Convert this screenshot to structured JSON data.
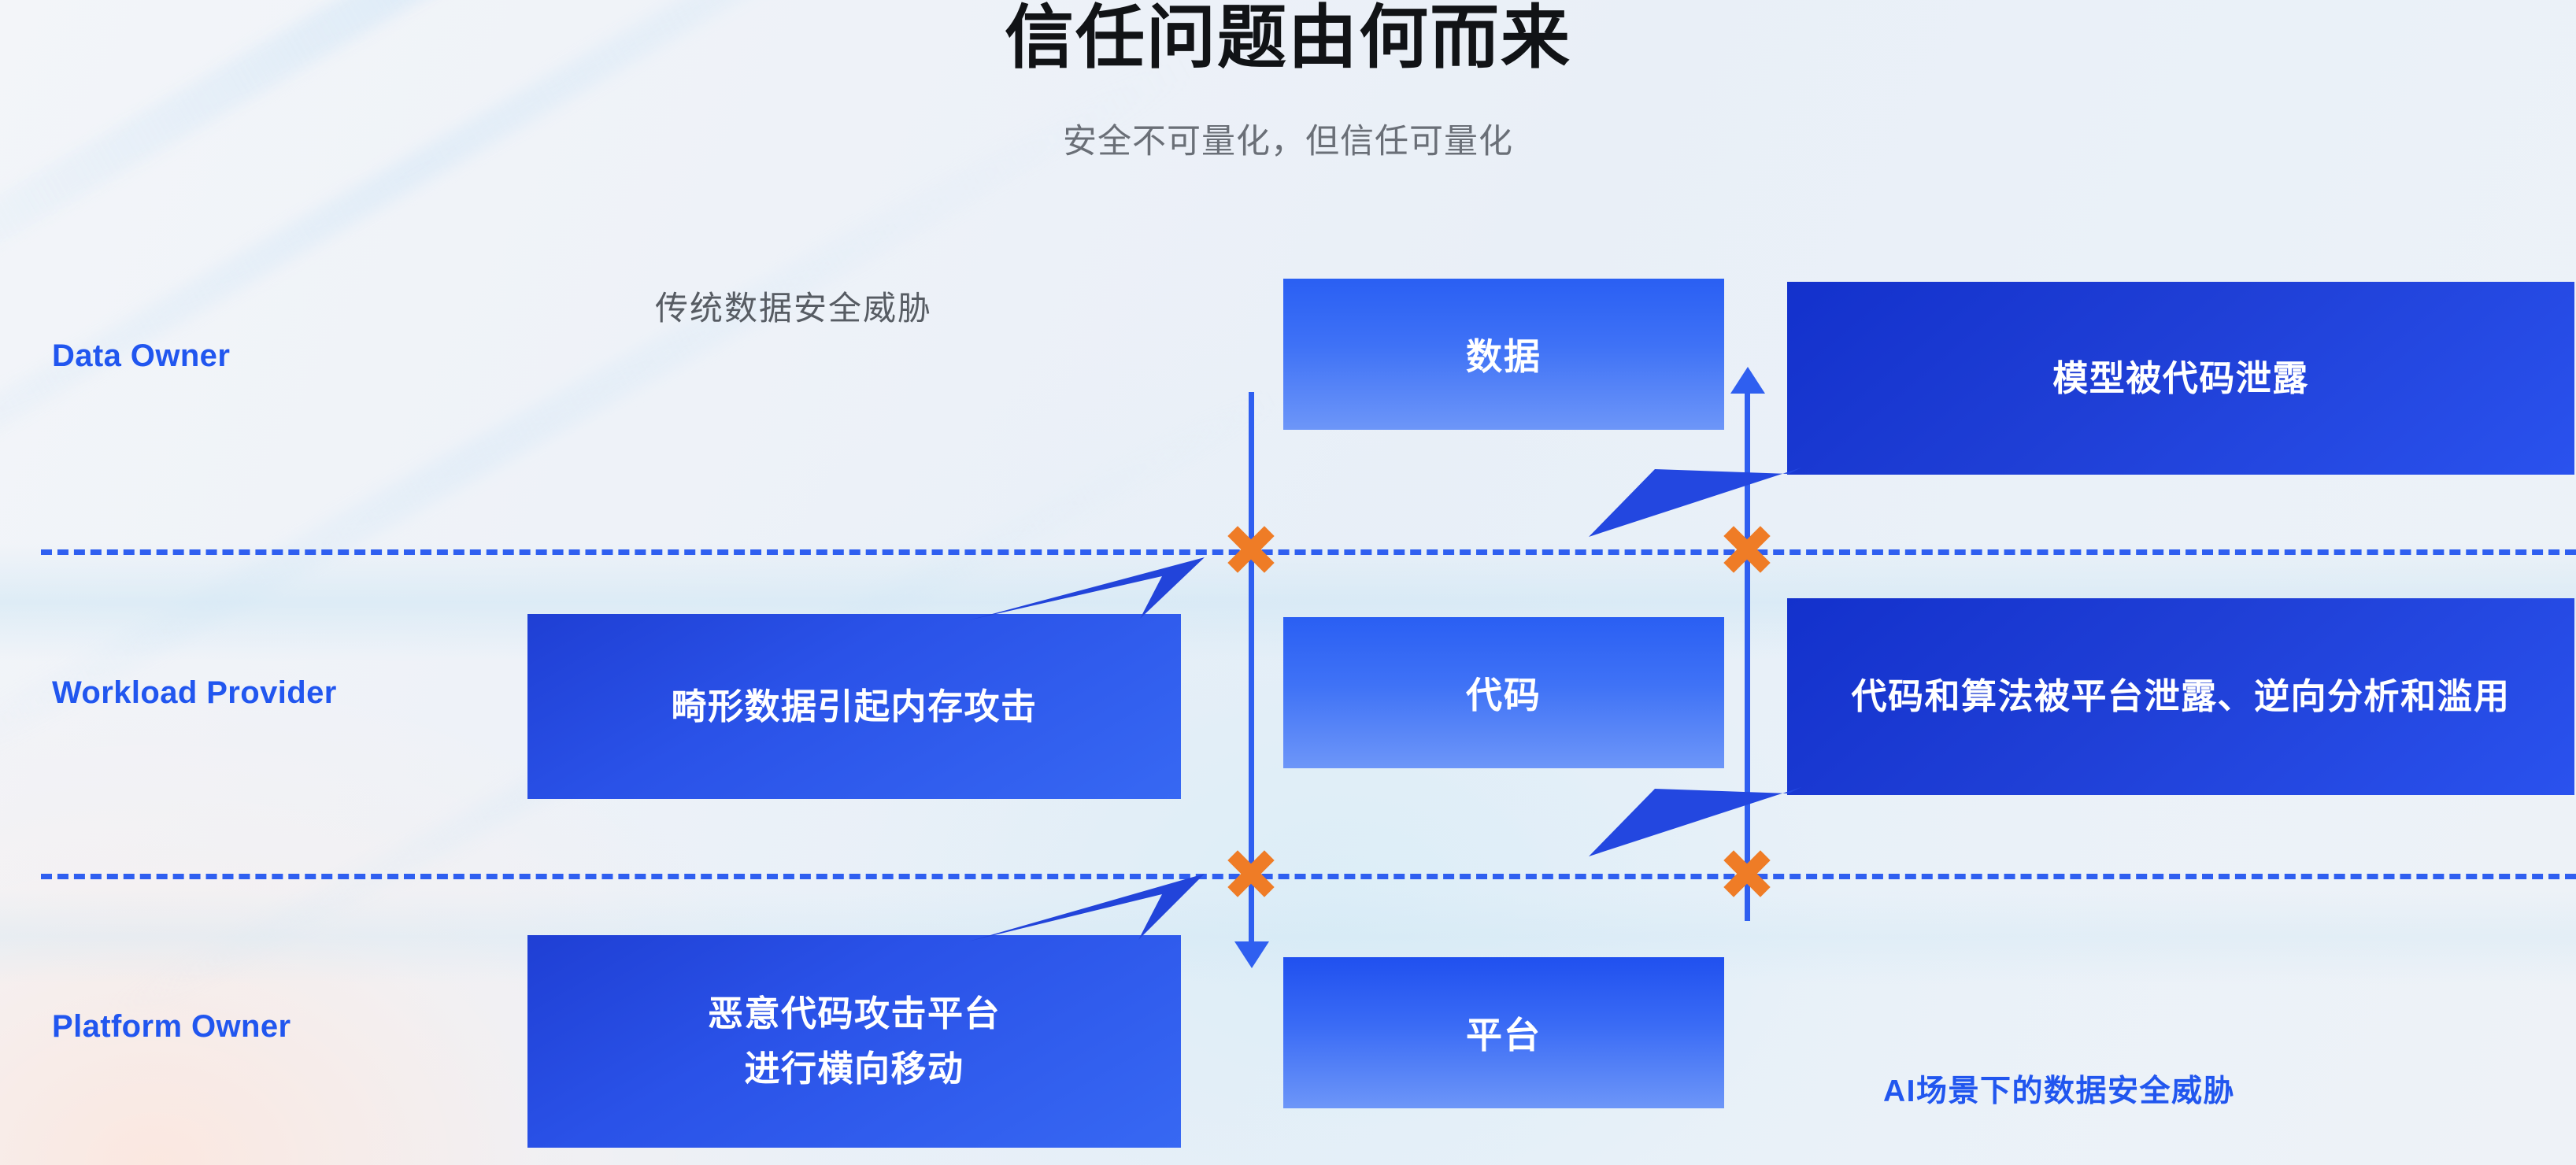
{
  "header": {
    "title": "信任问题由何而来",
    "subtitle": "安全不可量化，但信任可量化"
  },
  "colors": {
    "accent_blue": "#2156ef",
    "line_blue": "#2f5ff0",
    "box_blue_dark": "#1f3fd4",
    "box_blue_light": "#6d96f8",
    "marker_orange": "#ef7c26",
    "title_black": "#111316",
    "subtitle_gray": "#6a6f77"
  },
  "row_labels": [
    {
      "label": "Data Owner"
    },
    {
      "label": "Workload Provider"
    },
    {
      "label": "Platform Owner"
    }
  ],
  "section_labels": {
    "traditional": "传统数据安全威胁",
    "ai_scenario": "AI场景下的数据安全威胁"
  },
  "center_boxes": [
    {
      "label": "数据"
    },
    {
      "label": "代码"
    },
    {
      "label": "平台"
    }
  ],
  "left_callouts": [
    {
      "text": "畸形数据引起内存攻击"
    },
    {
      "line1": "恶意代码攻击平台",
      "line2": "进行横向移动"
    }
  ],
  "right_callouts": [
    {
      "text": "模型被代码泄露"
    },
    {
      "text": "代码和算法被平台泄露、逆向分析和滥用"
    }
  ]
}
